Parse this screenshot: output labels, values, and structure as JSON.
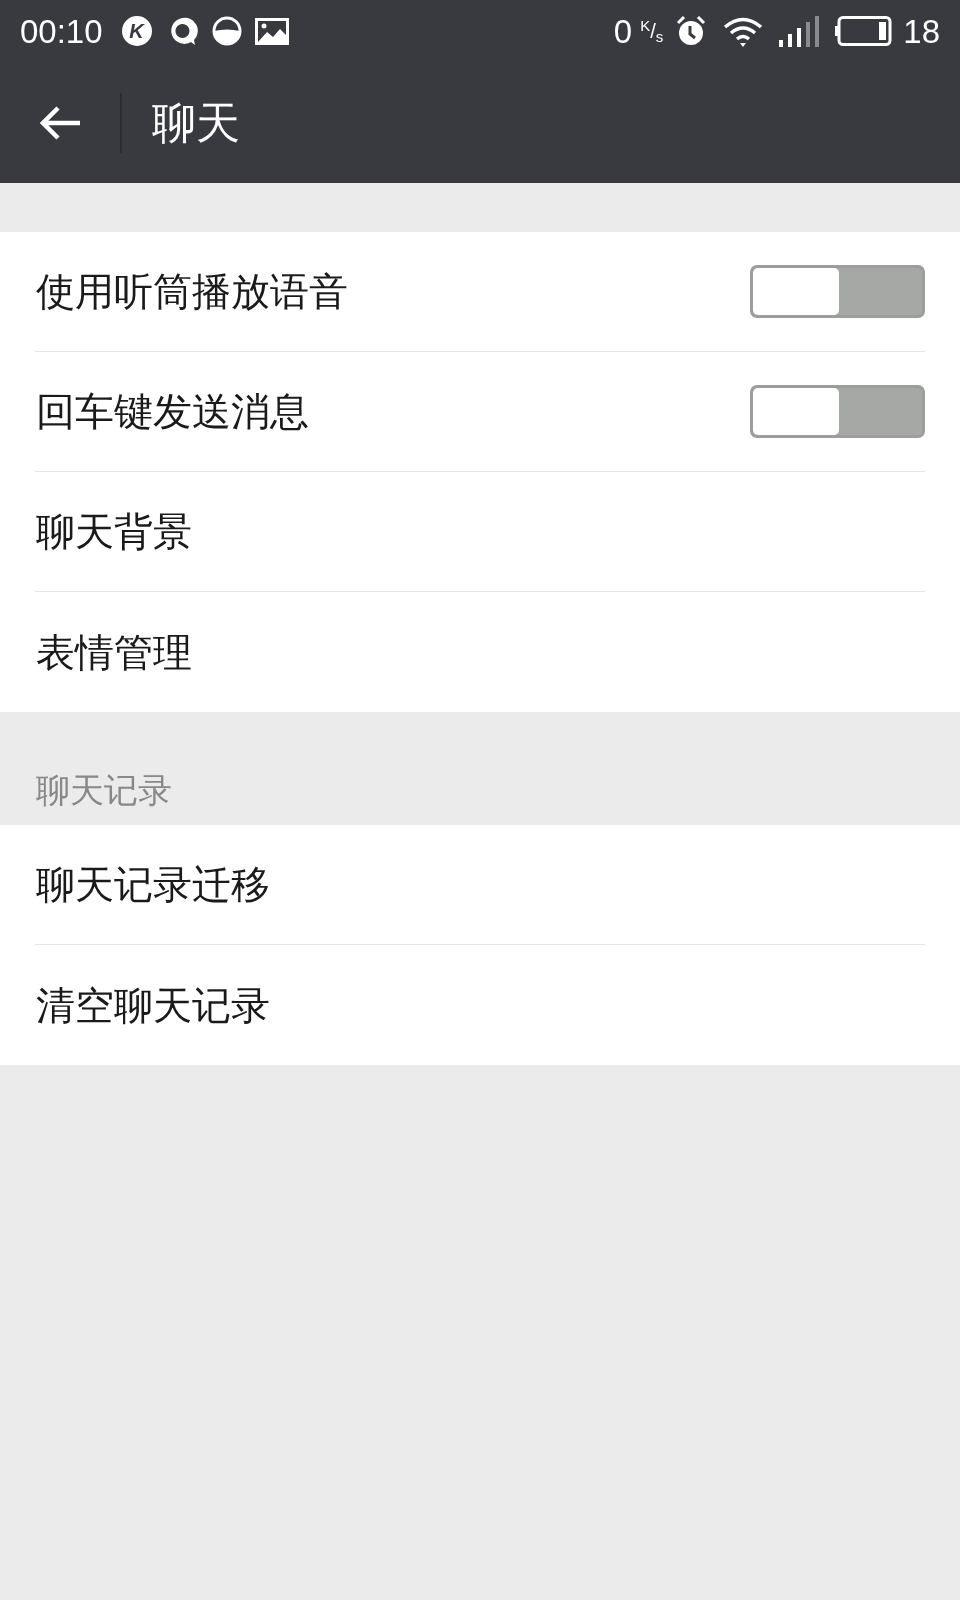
{
  "status_bar": {
    "time": "00:10",
    "app_badge": "K",
    "speed": "0",
    "speed_unit": "$^{K}$/$_{s}$",
    "battery": "18"
  },
  "toolbar": {
    "title": "聊天"
  },
  "sections": [
    {
      "items": [
        {
          "label": "使用听筒播放语音",
          "kind": "toggle",
          "on": false
        },
        {
          "label": "回车键发送消息",
          "kind": "toggle",
          "on": false
        },
        {
          "label": "聊天背景",
          "kind": "link"
        },
        {
          "label": "表情管理",
          "kind": "link"
        }
      ]
    },
    {
      "header": "聊天记录",
      "items": [
        {
          "label": "聊天记录迁移",
          "kind": "link"
        },
        {
          "label": "清空聊天记录",
          "kind": "link"
        }
      ]
    }
  ]
}
